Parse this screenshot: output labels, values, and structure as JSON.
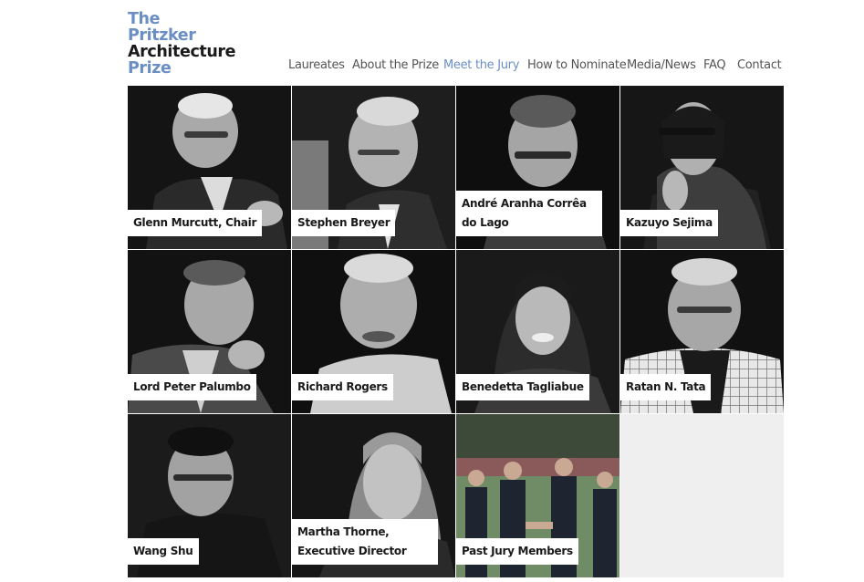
{
  "logo": {
    "line1": "The",
    "line2": "Pritzker",
    "line3": "Architecture",
    "line4": "Prize"
  },
  "nav": [
    {
      "label": "Laureates",
      "active": false
    },
    {
      "label": "About the Prize",
      "active": false
    },
    {
      "label": "Meet the Jury",
      "active": true
    },
    {
      "label": "How to Nominate",
      "active": false
    },
    {
      "label": "Media/News",
      "active": false
    },
    {
      "label": "FAQ",
      "active": false
    },
    {
      "label": "Contact",
      "active": false
    }
  ],
  "jury": [
    {
      "name": "Glenn Murcutt, Chair"
    },
    {
      "name": "Stephen Breyer"
    },
    {
      "name": "André Aranha Corrêa do Lago"
    },
    {
      "name": "Kazuyo Sejima"
    },
    {
      "name": "Lord Peter Palumbo"
    },
    {
      "name": "Richard Rogers"
    },
    {
      "name": "Benedetta Tagliabue"
    },
    {
      "name": "Ratan N. Tata"
    },
    {
      "name": "Wang Shu"
    },
    {
      "name": "Martha Thorne, Executive Director"
    },
    {
      "name": "Past Jury Members"
    }
  ],
  "colors": {
    "accent": "#6b8fc4",
    "text": "#1a1a1a",
    "nav_text": "#555555",
    "empty_tile": "#efefef"
  }
}
